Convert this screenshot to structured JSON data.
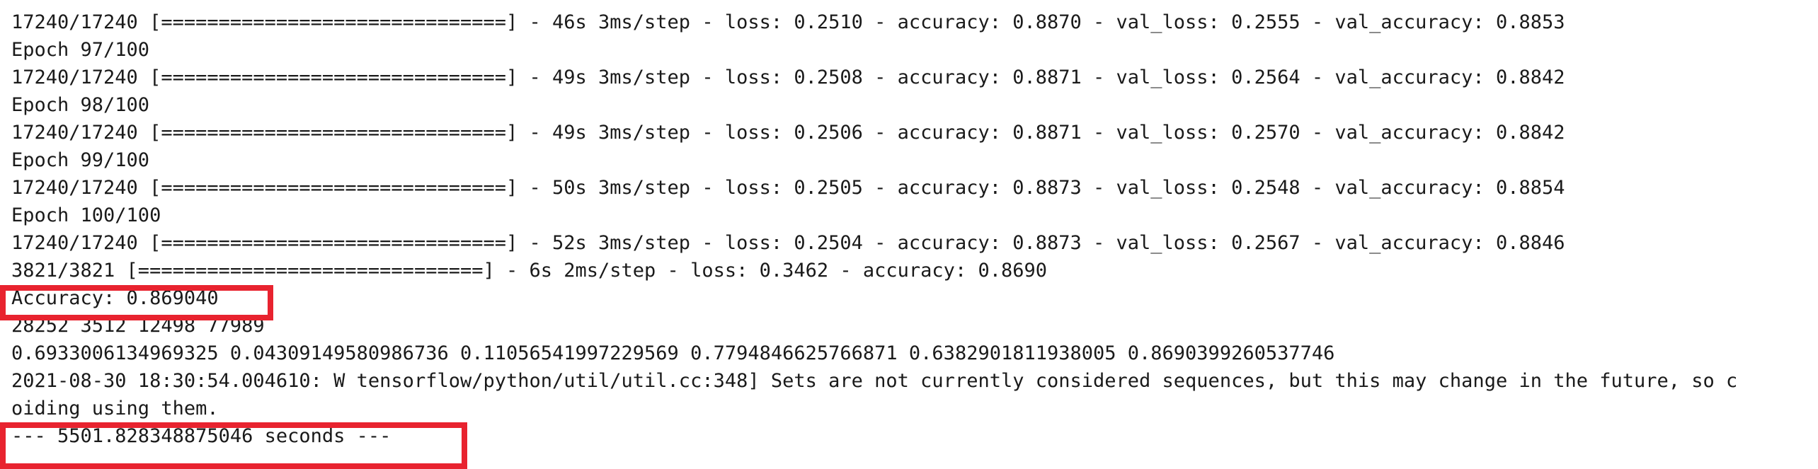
{
  "console": {
    "lines": [
      "17240/17240 [==============================] - 46s 3ms/step - loss: 0.2510 - accuracy: 0.8870 - val_loss: 0.2555 - val_accuracy: 0.8853",
      "Epoch 97/100",
      "17240/17240 [==============================] - 49s 3ms/step - loss: 0.2508 - accuracy: 0.8871 - val_loss: 0.2564 - val_accuracy: 0.8842",
      "Epoch 98/100",
      "17240/17240 [==============================] - 49s 3ms/step - loss: 0.2506 - accuracy: 0.8871 - val_loss: 0.2570 - val_accuracy: 0.8842",
      "Epoch 99/100",
      "17240/17240 [==============================] - 50s 3ms/step - loss: 0.2505 - accuracy: 0.8873 - val_loss: 0.2548 - val_accuracy: 0.8854",
      "Epoch 100/100",
      "17240/17240 [==============================] - 52s 3ms/step - loss: 0.2504 - accuracy: 0.8873 - val_loss: 0.2567 - val_accuracy: 0.8846",
      "3821/3821 [==============================] - 6s 2ms/step - loss: 0.3462 - accuracy: 0.8690",
      "Accuracy: 0.869040",
      "28252 3512 12498 77989",
      "0.6933006134969325 0.04309149580986736 0.11056541997229569 0.7794846625766871 0.6382901811938005 0.8690399260537746",
      "2021-08-30 18:30:54.004610: W tensorflow/python/util/util.cc:348] Sets are not currently considered sequences, but this may change in the future, so c",
      "oiding using them.",
      "--- 5501.828348875046 seconds ---"
    ]
  },
  "colors": {
    "text": "#1a1a1a",
    "background": "#ffffff",
    "highlight": "#e8232f"
  }
}
